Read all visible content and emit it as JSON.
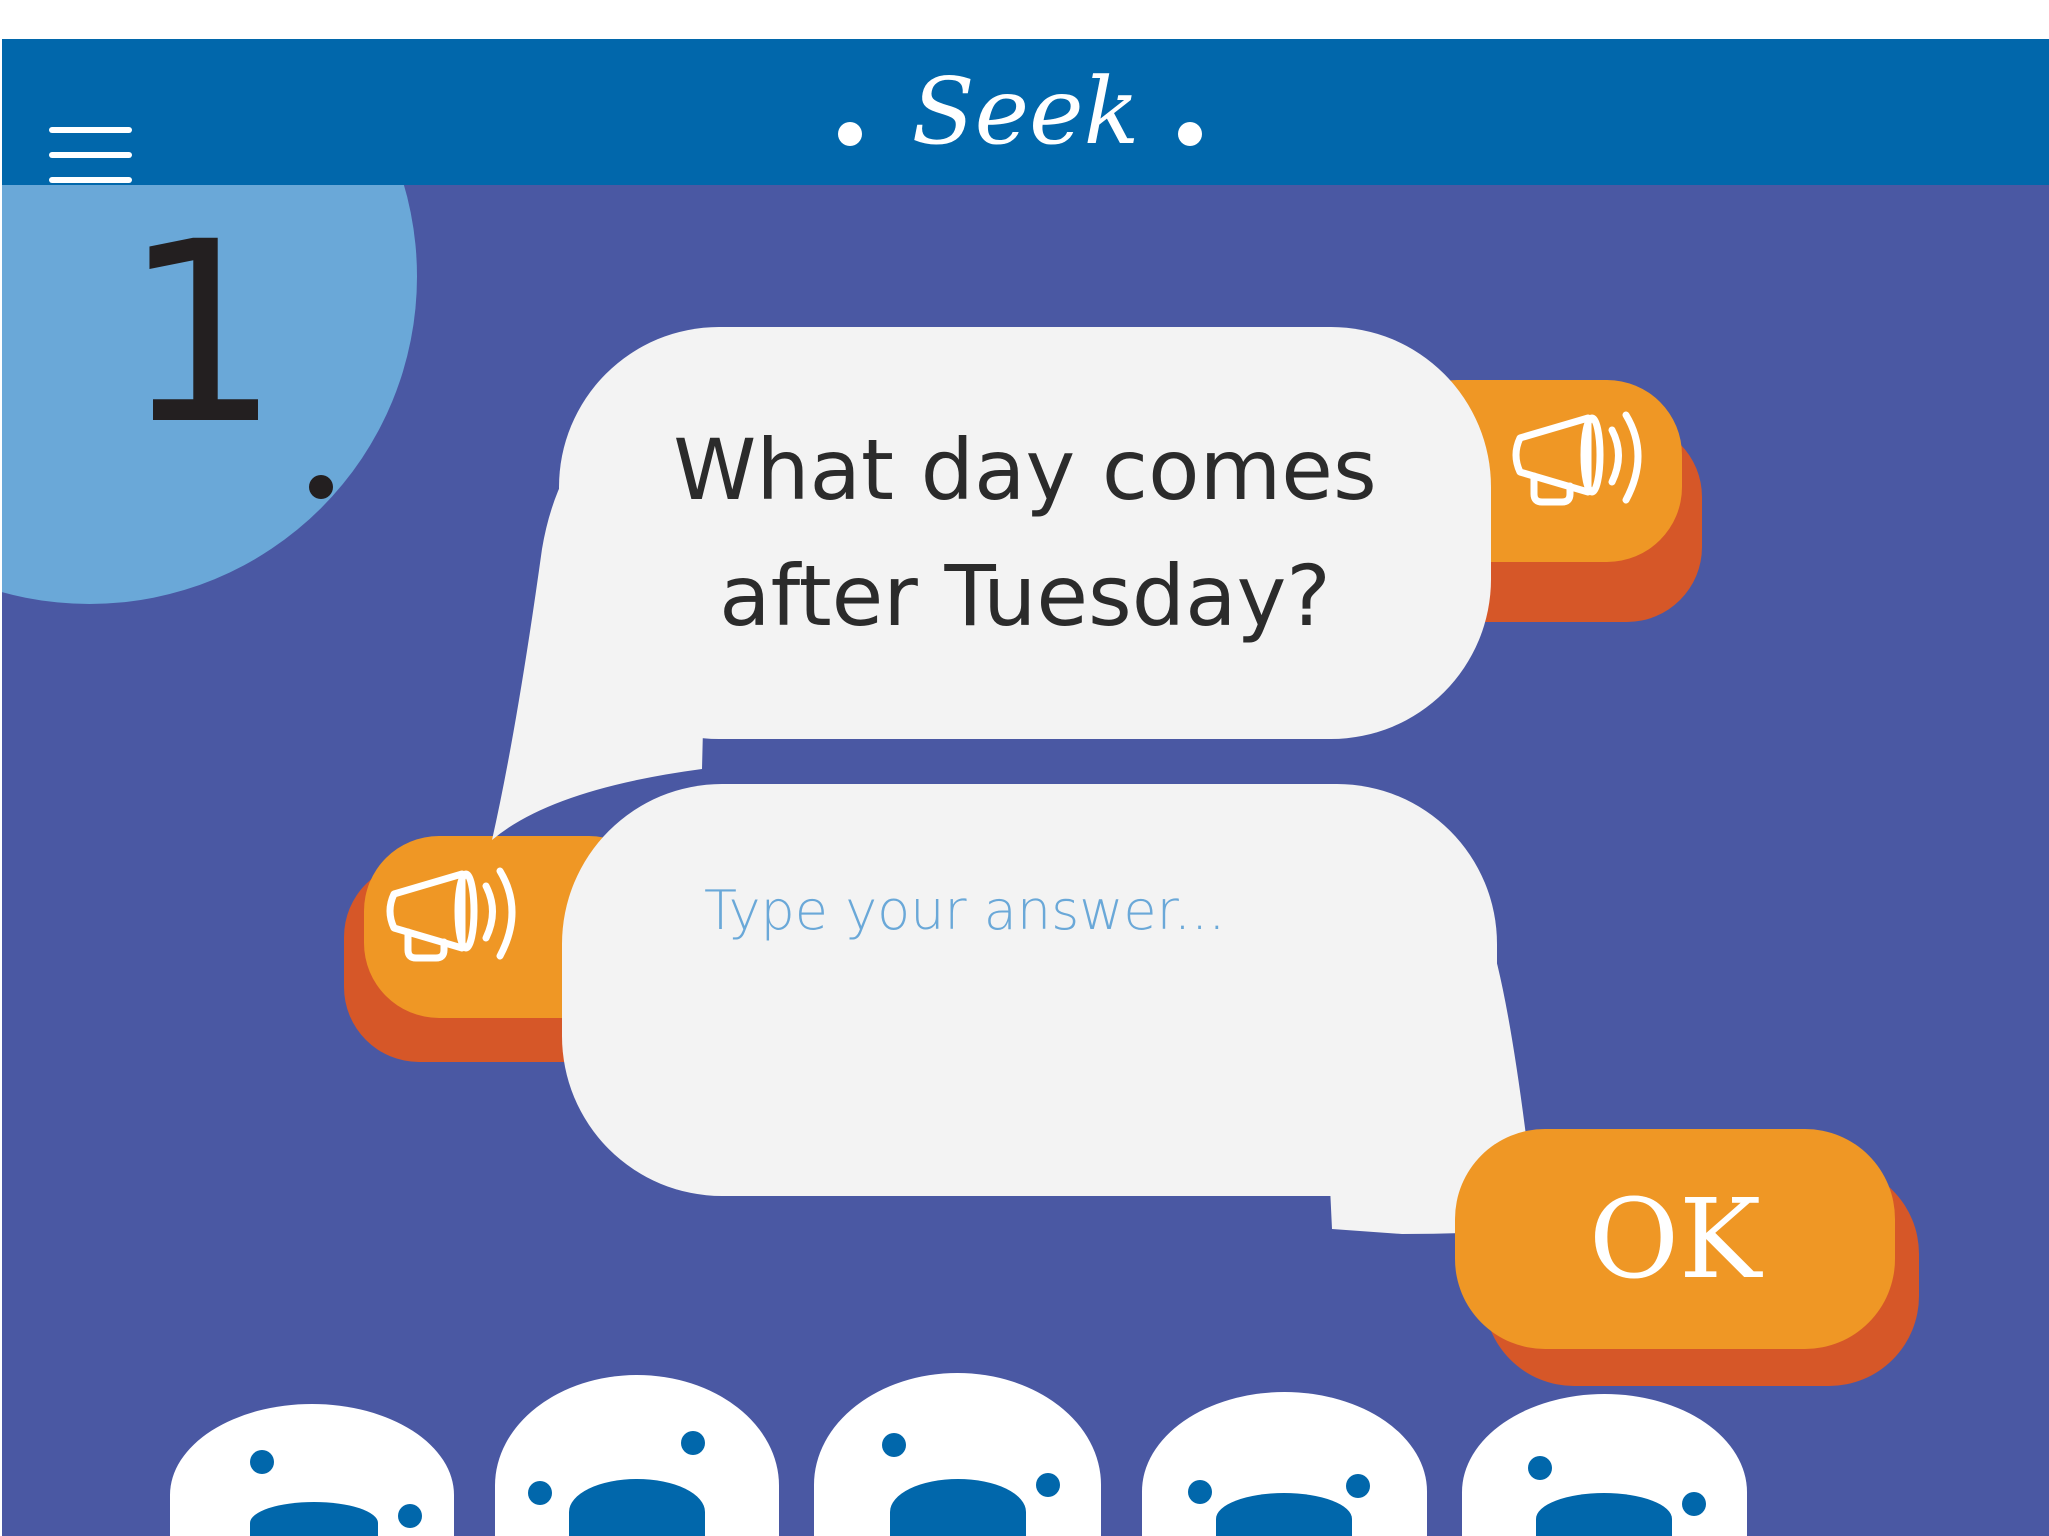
{
  "header": {
    "app_name": "Seek",
    "menu_icon": "hamburger-menu-icon"
  },
  "question": {
    "number": "1",
    "text": "What day comes after Tuesday?",
    "speaker_icon": "megaphone-icon"
  },
  "answer": {
    "placeholder": "Type your answer...",
    "speaker_icon": "megaphone-icon"
  },
  "ok_button": {
    "label": "OK"
  },
  "colors": {
    "background": "#4a58a3",
    "header": "#0167ab",
    "number_circle": "#6aa8d8",
    "bubble": "#f3f3f3",
    "button": "#ef9725",
    "button_shadow": "#d65728"
  },
  "characters": [
    {
      "name": "egg-character-1"
    },
    {
      "name": "egg-character-2"
    },
    {
      "name": "egg-character-3"
    },
    {
      "name": "egg-character-4"
    },
    {
      "name": "egg-character-5"
    }
  ]
}
